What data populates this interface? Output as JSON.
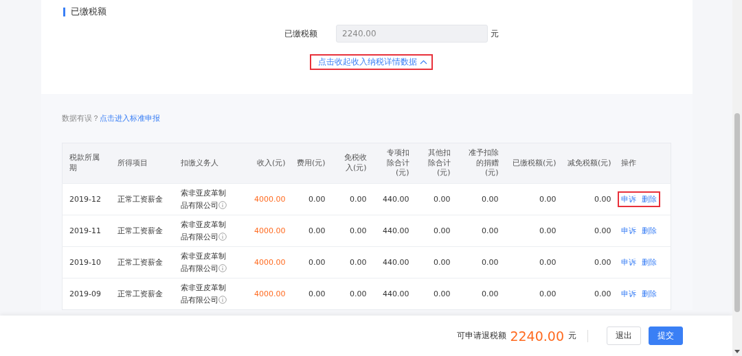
{
  "section": {
    "title": "已缴税额"
  },
  "paid_field": {
    "label": "已缴税额",
    "value": "2240.00",
    "unit": "元",
    "disabled": true
  },
  "toggle_link": {
    "text": "点击收起收入纳税详情数据",
    "expanded": true,
    "highlighted": true
  },
  "notice": {
    "text": "数据有误？",
    "link": "点击进入标准申报"
  },
  "table": {
    "columns": [
      {
        "label": "税款所属期",
        "kind": "text"
      },
      {
        "label": "所得项目",
        "kind": "text"
      },
      {
        "label": "扣缴义务人",
        "kind": "company"
      },
      {
        "label": "收入(元)",
        "kind": "income"
      },
      {
        "label": "费用(元)",
        "kind": "number"
      },
      {
        "label": "免税收入(元)",
        "kind": "number"
      },
      {
        "label": "专项扣除合计(元)",
        "kind": "number"
      },
      {
        "label": "其他扣除合计(元)",
        "kind": "number"
      },
      {
        "label": "准予扣除的捐赠(元)",
        "kind": "number"
      },
      {
        "label": "已缴税额(元)",
        "kind": "number"
      },
      {
        "label": "减免税额(元)",
        "kind": "number"
      },
      {
        "label": "操作",
        "kind": "actions"
      }
    ],
    "rows": [
      {
        "cells": [
          "2019-12",
          "正常工资薪金",
          "索非亚皮革制品有限公司",
          "4000.00",
          "0.00",
          "0.00",
          "440.00",
          "0.00",
          "0.00",
          "0.00",
          "0.00"
        ],
        "actions": [
          "申诉",
          "删除"
        ],
        "highlighted": true
      },
      {
        "cells": [
          "2019-11",
          "正常工资薪金",
          "索非亚皮革制品有限公司",
          "4000.00",
          "0.00",
          "0.00",
          "440.00",
          "0.00",
          "0.00",
          "0.00",
          "0.00"
        ],
        "actions": [
          "申诉",
          "删除"
        ],
        "highlighted": false
      },
      {
        "cells": [
          "2019-10",
          "正常工资薪金",
          "索非亚皮革制品有限公司",
          "4000.00",
          "0.00",
          "0.00",
          "440.00",
          "0.00",
          "0.00",
          "0.00",
          "0.00"
        ],
        "actions": [
          "申诉",
          "删除"
        ],
        "highlighted": false
      },
      {
        "cells": [
          "2019-09",
          "正常工资薪金",
          "索非亚皮革制品有限公司",
          "4000.00",
          "0.00",
          "0.00",
          "440.00",
          "0.00",
          "0.00",
          "0.00",
          "0.00"
        ],
        "actions": [
          "申诉",
          "删除"
        ],
        "highlighted": false
      }
    ]
  },
  "footer": {
    "label": "可申请退税额",
    "amount": "2240.00",
    "unit": "元",
    "buttons": [
      {
        "label": "退出",
        "kind": "default"
      },
      {
        "label": "提交",
        "kind": "primary"
      }
    ]
  }
}
